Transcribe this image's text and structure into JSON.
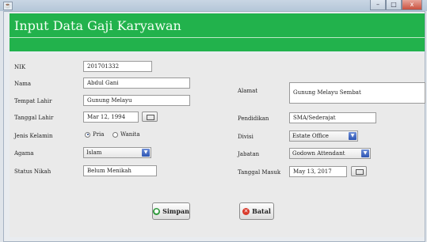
{
  "window": {
    "title": "",
    "min_label": "–",
    "max_label": "□",
    "close_label": "x"
  },
  "header": {
    "title": "Input Data Gaji Karyawan"
  },
  "form": {
    "nik": {
      "label": "NIK",
      "value": "201701332"
    },
    "nama": {
      "label": "Nama",
      "value": "Abdul Gani"
    },
    "tempat_lahir": {
      "label": "Tempat Lahir",
      "value": "Gunung Melayu"
    },
    "tanggal_lahir": {
      "label": "Tanggal Lahir",
      "value": "Mar 12, 1994"
    },
    "jenis_kelamin": {
      "label": "Jenis Kelamin",
      "options": [
        "Pria",
        "Wanita"
      ],
      "selected": "Pria"
    },
    "agama": {
      "label": "Agama",
      "value": "Islam"
    },
    "status_nikah": {
      "label": "Status Nikah",
      "value": "Belum Menikah"
    },
    "alamat": {
      "label": "Alamat",
      "value": "Gunung Melayu Sembat"
    },
    "pendidikan": {
      "label": "Pendidikan",
      "value": "SMA/Sederajat"
    },
    "divisi": {
      "label": "Divisi",
      "value": "Estate Office"
    },
    "jabatan": {
      "label": "Jabatan",
      "value": "Godown Attendant"
    },
    "tanggal_masuk": {
      "label": "Tanggal Masuk",
      "value": "May 13, 2017"
    }
  },
  "buttons": {
    "simpan": "Simpan",
    "batal": "Batal"
  },
  "colors": {
    "header_green": "#22b24c",
    "simpan_icon": "#2f9a3c",
    "batal_icon": "#d9392a"
  }
}
